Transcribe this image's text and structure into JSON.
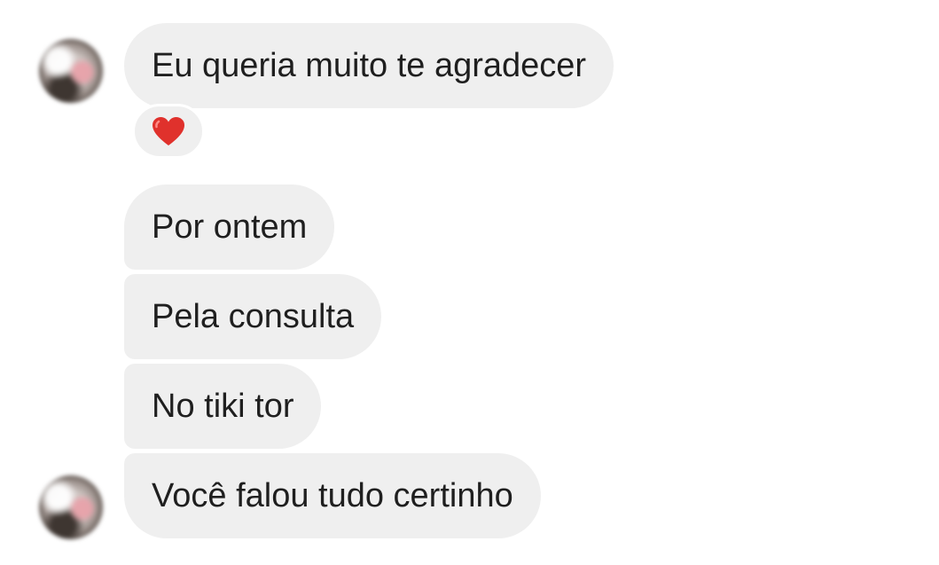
{
  "conversation": {
    "messages": [
      {
        "text": "Eu queria muito te agradecer",
        "reaction": "heart-icon"
      },
      {
        "text": "Por ontem"
      },
      {
        "text": "Pela consulta"
      },
      {
        "text": "No tiki tor"
      },
      {
        "text": "Você falou tudo certinho"
      }
    ],
    "colors": {
      "bubble_bg": "#efefef",
      "text": "#1f1f1f",
      "reaction_heart": "#e0312c"
    }
  }
}
